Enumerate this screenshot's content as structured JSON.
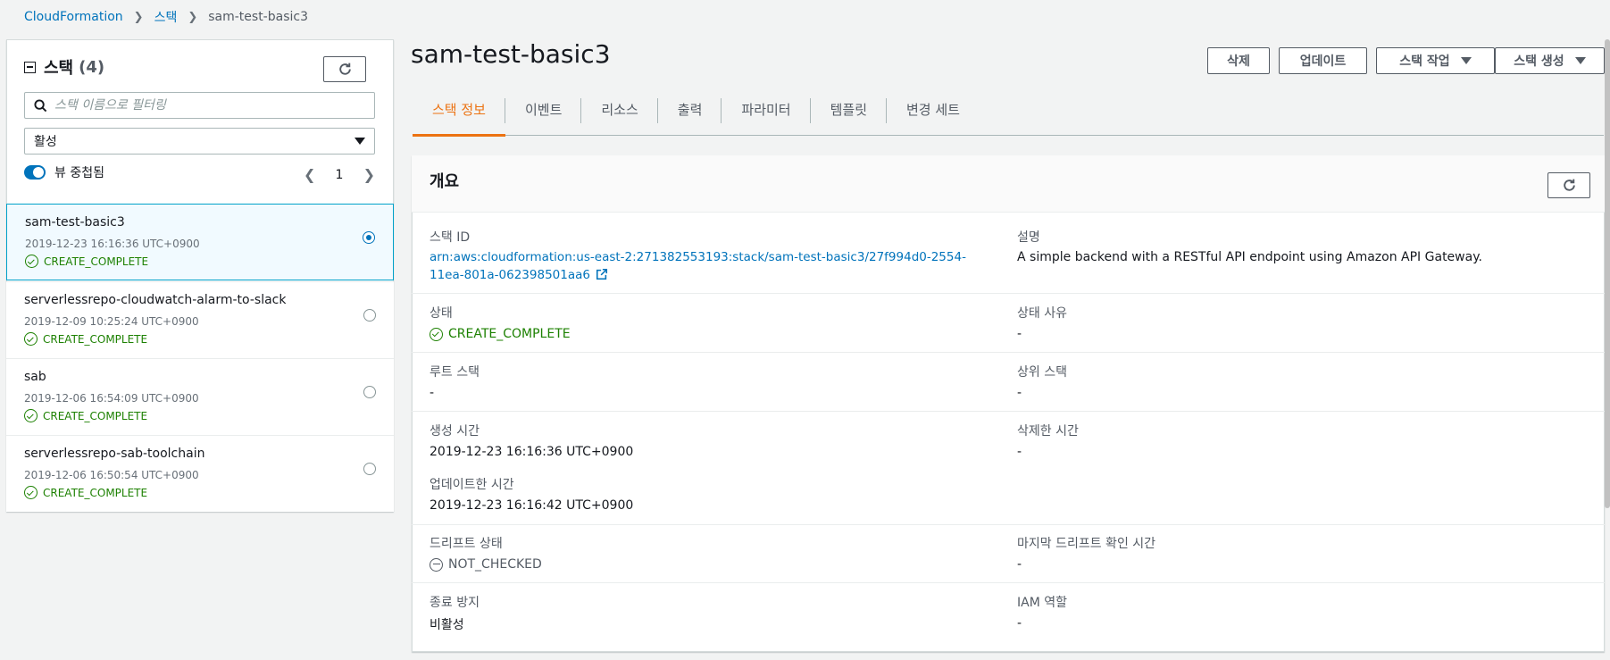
{
  "breadcrumb": {
    "root": "CloudFormation",
    "section": "스택",
    "current": "sam-test-basic3"
  },
  "left_panel": {
    "title": "스택",
    "count": "(4)",
    "search_placeholder": "스택 이름으로 필터링",
    "filter_value": "활성",
    "toggle_label": "뷰 중첩됨",
    "page_number": "1",
    "stacks": [
      {
        "name": "sam-test-basic3",
        "date": "2019-12-23 16:16:36 UTC+0900",
        "status": "CREATE_COMPLETE"
      },
      {
        "name": "serverlessrepo-cloudwatch-alarm-to-slack",
        "date": "2019-12-09 10:25:24 UTC+0900",
        "status": "CREATE_COMPLETE"
      },
      {
        "name": "sab",
        "date": "2019-12-06 16:54:09 UTC+0900",
        "status": "CREATE_COMPLETE"
      },
      {
        "name": "serverlessrepo-sab-toolchain",
        "date": "2019-12-06 16:50:54 UTC+0900",
        "status": "CREATE_COMPLETE"
      }
    ]
  },
  "header": {
    "title": "sam-test-basic3",
    "buttons": {
      "delete": "삭제",
      "update": "업데이트",
      "stack_actions": "스택 작업",
      "create_stack": "스택 생성"
    }
  },
  "tabs": [
    {
      "label": "스택 정보"
    },
    {
      "label": "이벤트"
    },
    {
      "label": "리소스"
    },
    {
      "label": "출력"
    },
    {
      "label": "파라미터"
    },
    {
      "label": "템플릿"
    },
    {
      "label": "변경 세트"
    }
  ],
  "overview": {
    "title": "개요",
    "stack_id_label": "스택 ID",
    "stack_id_value": "arn:aws:cloudformation:us-east-2:271382553193:stack/sam-test-basic3/27f994d0-2554-11ea-801a-062398501aa6",
    "description_label": "설명",
    "description_value": "A simple backend with a RESTful API endpoint using Amazon API Gateway.",
    "status_label": "상태",
    "status_value": "CREATE_COMPLETE",
    "status_reason_label": "상태 사유",
    "status_reason_value": "-",
    "root_stack_label": "루트 스택",
    "root_stack_value": "-",
    "parent_stack_label": "상위 스택",
    "parent_stack_value": "-",
    "created_label": "생성 시간",
    "created_value": "2019-12-23 16:16:36 UTC+0900",
    "deleted_label": "삭제한 시간",
    "deleted_value": "-",
    "updated_label": "업데이트한 시간",
    "updated_value": "2019-12-23 16:16:42 UTC+0900",
    "drift_label": "드리프트 상태",
    "drift_value": "NOT_CHECKED",
    "last_drift_label": "마지막 드리프트 확인 시간",
    "last_drift_value": "-",
    "termination_label": "종료 방지",
    "termination_value": "비활성",
    "iam_label": "IAM 역할",
    "iam_value": "-"
  },
  "colors": {
    "link": "#0073bb",
    "success": "#1d8102",
    "active_tab": "#ec7211"
  }
}
